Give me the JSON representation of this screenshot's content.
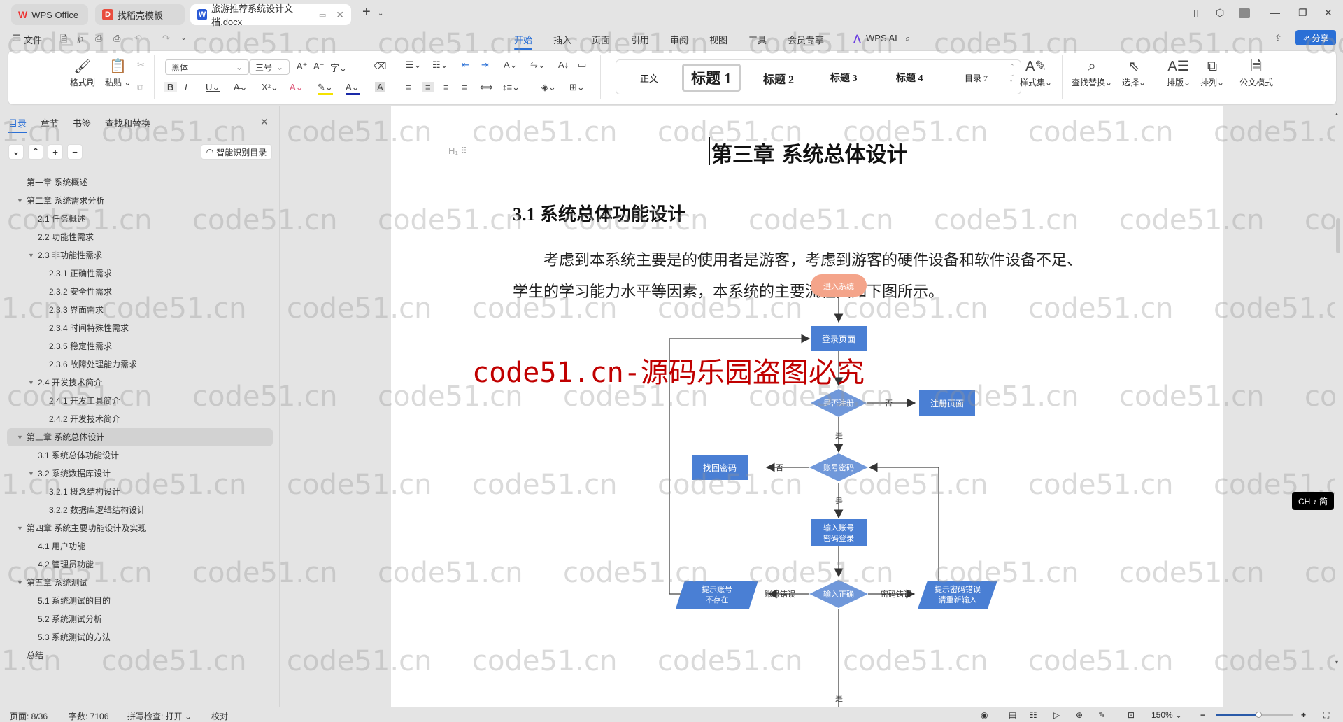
{
  "tabs": [
    {
      "label": "WPS Office",
      "icon": "wps-logo-icon"
    },
    {
      "label": "找稻壳模板",
      "icon": "docer-icon"
    },
    {
      "label": "旅游推荐系统设计文档.docx",
      "icon": "word-doc-icon",
      "active": true
    }
  ],
  "menu": {
    "file_label": "文件",
    "items": [
      "开始",
      "插入",
      "页面",
      "引用",
      "审阅",
      "视图",
      "工具",
      "会员专享"
    ],
    "active": "开始",
    "ai_label": "WPS AI",
    "share_label": "分享"
  },
  "ribbon": {
    "format_painter": "格式刷",
    "paste": "粘贴",
    "font_name": "黑体",
    "font_size": "三号",
    "styles": [
      "正文",
      "标题 1",
      "标题 2",
      "标题 3",
      "标题 4",
      "目录 7"
    ],
    "selected_style": "标题 1",
    "style_set": "样式集",
    "find_replace": "查找替换",
    "select": "选择",
    "layout": "排版",
    "arrange": "排列",
    "official_mode": "公文模式"
  },
  "sidebar": {
    "tabs": [
      "目录",
      "章节",
      "书签",
      "查找和替换"
    ],
    "active_tab": "目录",
    "smart_toc_label": "智能识别目录",
    "toc": [
      {
        "label": "第一章  系统概述",
        "level": 1,
        "expanded": null
      },
      {
        "label": "第二章  系统需求分析",
        "level": 1,
        "expanded": true
      },
      {
        "label": "2.1  任务概述",
        "level": 2,
        "expanded": null
      },
      {
        "label": "2.2  功能性需求",
        "level": 2,
        "expanded": null
      },
      {
        "label": "2.3  非功能性需求",
        "level": 2,
        "expanded": true
      },
      {
        "label": "2.3.1 正确性需求",
        "level": 3,
        "expanded": null
      },
      {
        "label": "2.3.2 安全性需求",
        "level": 3,
        "expanded": null
      },
      {
        "label": "2.3.3 界面需求",
        "level": 3,
        "expanded": null
      },
      {
        "label": "2.3.4 时间特殊性需求",
        "level": 3,
        "expanded": null
      },
      {
        "label": "2.3.5 稳定性需求",
        "level": 3,
        "expanded": null
      },
      {
        "label": "2.3.6 故障处理能力需求",
        "level": 3,
        "expanded": null
      },
      {
        "label": "2.4  开发技术简介",
        "level": 2,
        "expanded": true
      },
      {
        "label": "2.4.1  开发工具简介",
        "level": 3,
        "expanded": null
      },
      {
        "label": "2.4.2  开发技术简介",
        "level": 3,
        "expanded": null
      },
      {
        "label": "第三章  系统总体设计",
        "level": 1,
        "expanded": true,
        "active": true
      },
      {
        "label": "3.1  系统总体功能设计",
        "level": 2,
        "expanded": null
      },
      {
        "label": "3.2  系统数据库设计",
        "level": 2,
        "expanded": true
      },
      {
        "label": "3.2.1  概念结构设计",
        "level": 3,
        "expanded": null
      },
      {
        "label": "3.2.2  数据库逻辑结构设计",
        "level": 3,
        "expanded": null
      },
      {
        "label": "第四章  系统主要功能设计及实现",
        "level": 1,
        "expanded": true
      },
      {
        "label": "4.1 用户功能",
        "level": 2,
        "expanded": null
      },
      {
        "label": "4.2 管理员功能",
        "level": 2,
        "expanded": null
      },
      {
        "label": "第五章  系统测试",
        "level": 1,
        "expanded": true
      },
      {
        "label": "5.1  系统测试的目的",
        "level": 2,
        "expanded": null
      },
      {
        "label": "5.2  系统测试分析",
        "level": 2,
        "expanded": null
      },
      {
        "label": "5.3  系统测试的方法",
        "level": 2,
        "expanded": null
      },
      {
        "label": "总结",
        "level": 1,
        "expanded": null
      }
    ]
  },
  "document": {
    "heading1": "第三章  系统总体设计",
    "heading2": "3.1  系统总体功能设计",
    "para_line1": "考虑到本系统主要是的使用者是游客，考虑到游客的硬件设备和软件设备不足、",
    "para_line2": "学生的学习能力水平等因素，本系统的主要流程图如下图所示。",
    "flowchart": {
      "start": "进入系统",
      "login_page": "登录页面",
      "is_registered": "是否注册",
      "register_page": "注册页面",
      "account_password": "账号密码",
      "retrieve_password": "找回密码",
      "enter_login": [
        "输入账号",
        "密码登录"
      ],
      "input_correct": "输入正确",
      "account_not_exist": [
        "提示账号",
        "不存在"
      ],
      "password_error_prompt": [
        "提示密码错误",
        "请重新输入"
      ],
      "yes": "是",
      "no": "否",
      "account_error": "账号错误",
      "password_error": "密码错误"
    }
  },
  "watermark": {
    "text": "code51.cn",
    "banner": "code51.cn-源码乐园盗图必究"
  },
  "ime": "CH ♪ 简",
  "status": {
    "page": "页面: 8/36",
    "words": "字数: 7106",
    "spell": "拼写检查: 打开",
    "proof": "校对",
    "zoom": "150%",
    "zoom_fraction": 0.55
  },
  "colors": {
    "accent": "#2a6fd6",
    "flow_box": "#4a7fd4",
    "flow_diamond": "#7098da",
    "flow_start": "#f4a48a",
    "red_watermark": "#c00000"
  }
}
